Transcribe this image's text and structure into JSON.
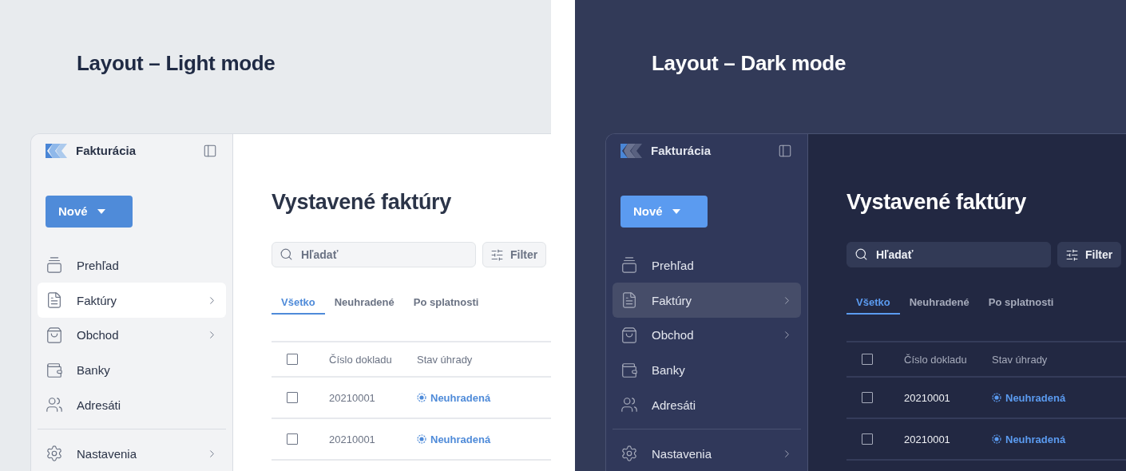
{
  "panels": [
    {
      "title": "Layout – Light mode",
      "kind": "light",
      "app": {
        "brand": "Fakturácia",
        "new_button": "Nové",
        "nav": [
          {
            "label": "Prehľad",
            "selected": false,
            "expandable": false
          },
          {
            "label": "Faktúry",
            "selected": true,
            "expandable": true
          },
          {
            "label": "Obchod",
            "selected": false,
            "expandable": true
          },
          {
            "label": "Banky",
            "selected": false,
            "expandable": false
          },
          {
            "label": "Adresáti",
            "selected": false,
            "expandable": false
          }
        ],
        "settings": {
          "label": "Nastavenia",
          "selected": false,
          "expandable": true
        },
        "heading": "Vystavené faktúry",
        "search": {
          "placeholder": "Hľadať"
        },
        "filter_button": "Filter",
        "tabs": [
          {
            "label": "Všetko",
            "selected": true
          },
          {
            "label": "Neuhradené",
            "selected": false
          },
          {
            "label": "Po splatnosti",
            "selected": false
          }
        ],
        "table": {
          "header_checked": false,
          "columns": [
            "Číslo dokladu",
            "Stav úhrady"
          ],
          "rows": [
            {
              "checked": false,
              "number": "20210001",
              "status": "Neuhradená"
            },
            {
              "checked": false,
              "number": "20210001",
              "status": "Neuhradená"
            }
          ]
        }
      }
    },
    {
      "title": "Layout – Dark mode",
      "kind": "dark",
      "app": {
        "brand": "Fakturácia",
        "new_button": "Nové",
        "nav": [
          {
            "label": "Prehľad",
            "selected": false,
            "expandable": false
          },
          {
            "label": "Faktúry",
            "selected": true,
            "expandable": true
          },
          {
            "label": "Obchod",
            "selected": false,
            "expandable": true
          },
          {
            "label": "Banky",
            "selected": false,
            "expandable": false
          },
          {
            "label": "Adresáti",
            "selected": false,
            "expandable": false
          }
        ],
        "settings": {
          "label": "Nastavenia",
          "selected": false,
          "expandable": true
        },
        "heading": "Vystavené faktúry",
        "search": {
          "placeholder": "Hľadať"
        },
        "filter_button": "Filter",
        "tabs": [
          {
            "label": "Všetko",
            "selected": true
          },
          {
            "label": "Neuhradené",
            "selected": false
          },
          {
            "label": "Po splatnosti",
            "selected": false
          }
        ],
        "table": {
          "header_checked": false,
          "columns": [
            "Číslo dokladu",
            "Stav úhrady"
          ],
          "rows": [
            {
              "checked": false,
              "number": "20210001",
              "status": "Neuhradená"
            },
            {
              "checked": false,
              "number": "20210001",
              "status": "Neuhradená"
            }
          ]
        }
      }
    }
  ]
}
